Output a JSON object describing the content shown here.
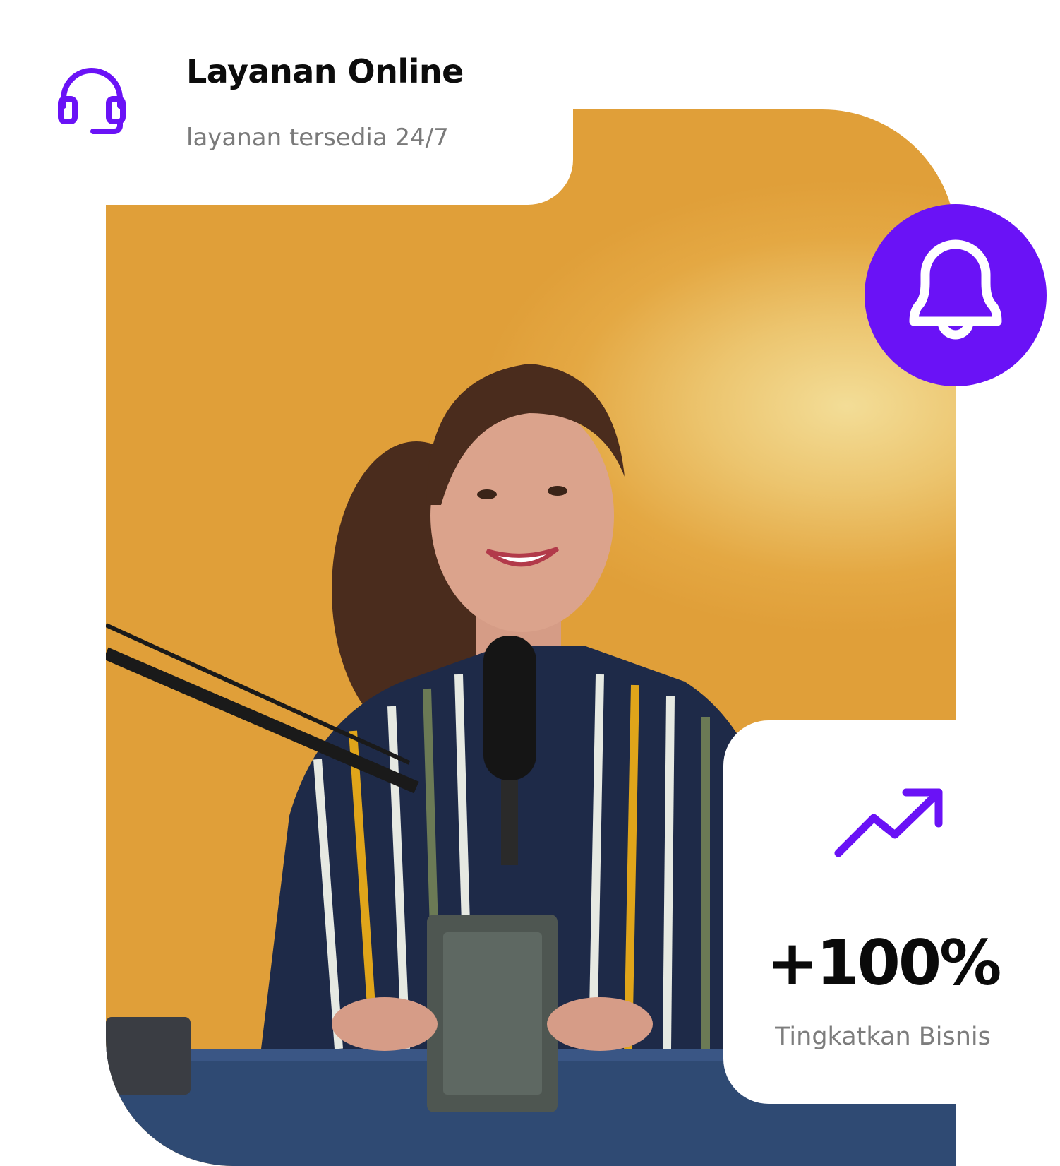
{
  "service_card": {
    "title": "Layanan Online",
    "subtitle": "layanan tersedia 24/7",
    "icon": "headset-icon"
  },
  "notification": {
    "icon": "bell-icon"
  },
  "stat_card": {
    "icon": "trend-up-icon",
    "value": "+100%",
    "label": "Tingkatkan Bisnis"
  },
  "colors": {
    "accent": "#6a12f6",
    "background_photo": "#e3a640",
    "text_dark": "#0c0c0c",
    "text_muted": "#7a7a7a"
  }
}
